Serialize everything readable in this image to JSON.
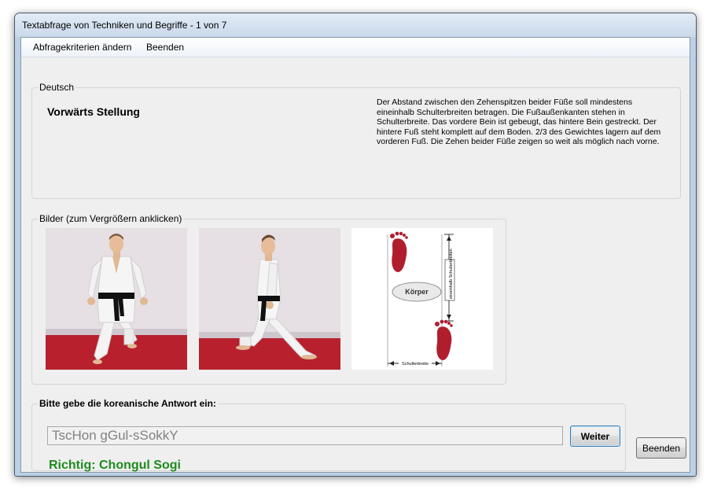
{
  "window": {
    "title": "Textabfrage von Techniken und Begriffe - 1 von 7"
  },
  "menu": {
    "items": [
      "Abfragekriterien ändern",
      "Beenden"
    ]
  },
  "deutsch": {
    "legend": "Deutsch",
    "term": "Vorwärts Stellung",
    "description": "Der Abstand zwischen den Zehenspitzen beider Füße soll mindestens eineinhalb Schulterbreiten betragen. Die Fußaußenkanten stehen in Schulterbreite. Das vordere Bein ist gebeugt, das hintere Bein gestreckt. Der hintere Fuß steht komplett auf dem Boden. 2/3 des Gewichtes lagern auf dem vorderen Fuß. Die Zehen beider Füße zeigen so weit als möglich nach vorne."
  },
  "bilder": {
    "legend": "Bilder (zum Vergrößern anklicken)",
    "diagram": {
      "body_label": "Körper",
      "vertical_label": "eineinhalb Schulterbreiten",
      "bottom_label": "Schulterbreite"
    }
  },
  "answer": {
    "legend": "Bitte gebe die koreanische Antwort ein:",
    "input_value": "TscHon gGul-sSokkY",
    "submit_label": "Weiter",
    "result": "Richtig: Chongul Sogi",
    "result_color": "#1e8c1e"
  },
  "footer": {
    "close_label": "Beenden"
  }
}
